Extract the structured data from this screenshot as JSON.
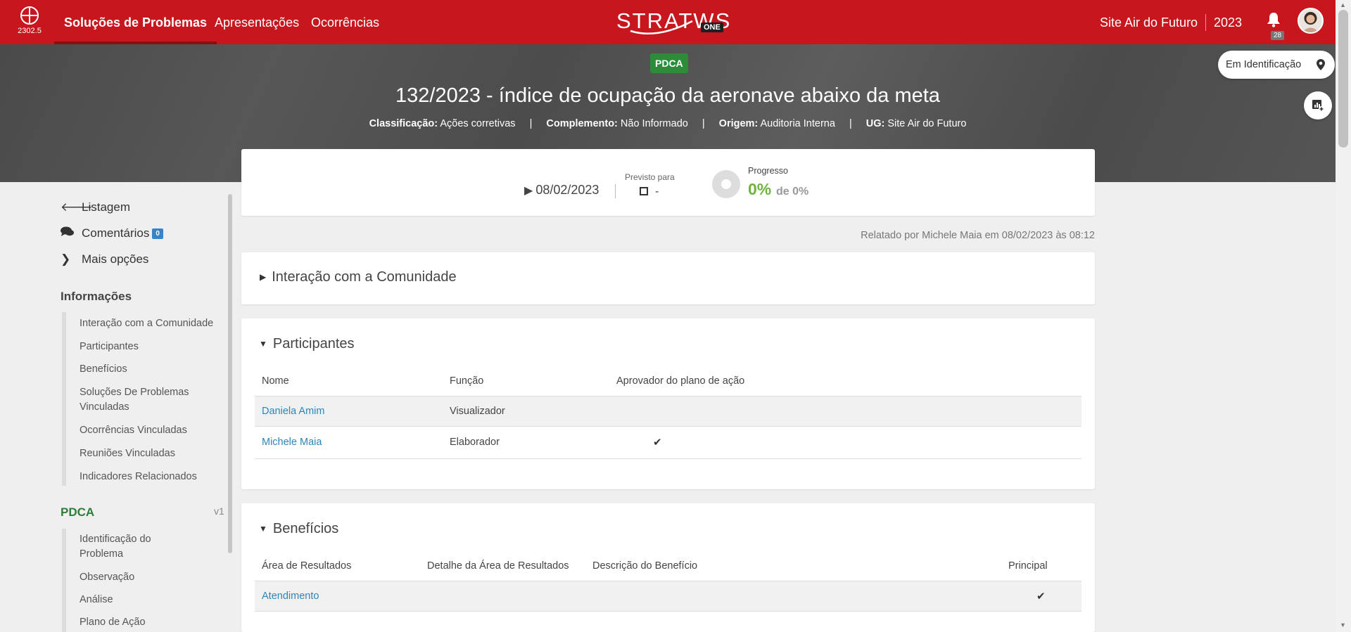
{
  "topbar": {
    "version": "2302.5",
    "nav": [
      "Soluções de Problemas",
      "Apresentações",
      "Ocorrências"
    ],
    "brand": "STRATWS",
    "brand_suffix": "ONE",
    "site": "Site Air do Futuro",
    "year": "2023",
    "notifications": "28",
    "colors": {
      "bar": "#c8161f",
      "active_underline": "#8e0d13"
    }
  },
  "banner": {
    "badge": "PDCA",
    "title": "132/2023 - índice de ocupação da aeronave abaixo da meta",
    "meta": [
      {
        "label": "Classificação:",
        "value": "Ações corretivas"
      },
      {
        "label": "Complemento:",
        "value": "Não Informado"
      },
      {
        "label": "Origem:",
        "value": "Auditoria Interna"
      },
      {
        "label": "UG:",
        "value": "Site Air do Futuro"
      }
    ],
    "separator": "|",
    "status": "Em Identificação",
    "status_icon": "map-marker-icon",
    "action_icon": "add-chart-icon"
  },
  "dates": {
    "start": "08/02/2023",
    "forecast_label": "Previsto para",
    "forecast_value": "-",
    "progress_label": "Progresso",
    "progress_value": "0%",
    "progress_of": "de 0%",
    "progress_color": "#6fb43f"
  },
  "reported": "Relatado por Michele Maia em 08/02/2023 às 08:12",
  "sections": {
    "community": {
      "title": "Interação com a Comunidade",
      "expanded": false
    },
    "participants": {
      "title": "Participantes",
      "headers": [
        "Nome",
        "Função",
        "Aprovador do plano de ação"
      ],
      "rows": [
        {
          "name": "Daniela Amim",
          "role": "Visualizador",
          "approver": ""
        },
        {
          "name": "Michele Maia",
          "role": "Elaborador",
          "approver": "✔"
        }
      ]
    },
    "benefits": {
      "title": "Benefícios",
      "headers": [
        "Área de Resultados",
        "Detalhe da Área de Resultados",
        "Descrição do Benefício",
        "Principal"
      ],
      "rows": [
        {
          "area": "Atendimento",
          "detail": "",
          "description": "",
          "main": "✔"
        }
      ]
    }
  },
  "sidebar": {
    "links": [
      {
        "label": "Listagem",
        "icon": "arrow-left-icon"
      },
      {
        "label": "Comentários",
        "icon": "comments-icon",
        "count": "0"
      },
      {
        "label": "Mais opções",
        "icon": "chevron-right-icon"
      }
    ],
    "info_title": "Informações",
    "info_items": [
      "Interação com a Comunidade",
      "Participantes",
      "Benefícios",
      "Soluções De Problemas Vinculadas",
      "Ocorrências Vinculadas",
      "Reuniões Vinculadas",
      "Indicadores Relacionados"
    ],
    "pdca_title": "PDCA",
    "pdca_version": "v1",
    "pdca_items": [
      "Identificação do Problema",
      "Observação",
      "Análise",
      "Plano de Ação"
    ]
  }
}
